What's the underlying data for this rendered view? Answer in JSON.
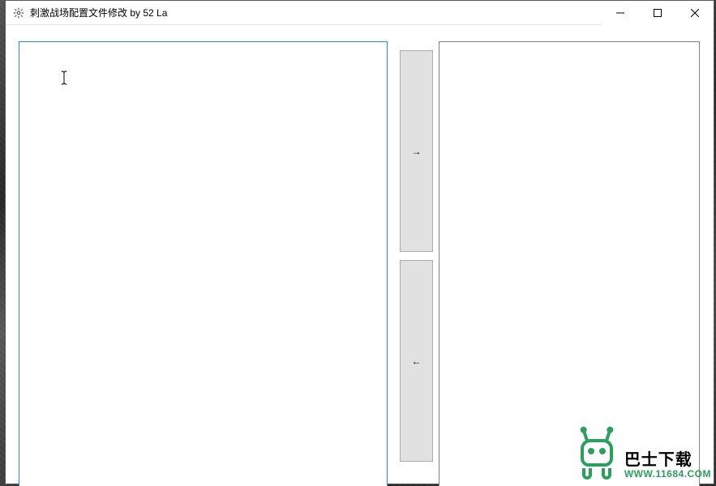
{
  "window": {
    "title": "刺激战场配置文件修改  by 52 La"
  },
  "buttons": {
    "to_right": "→",
    "to_left": "←"
  },
  "panes": {
    "left_value": "",
    "right_value": ""
  },
  "watermark": {
    "brand_cn": "巴士下载",
    "url": "WWW.11684.COM"
  }
}
